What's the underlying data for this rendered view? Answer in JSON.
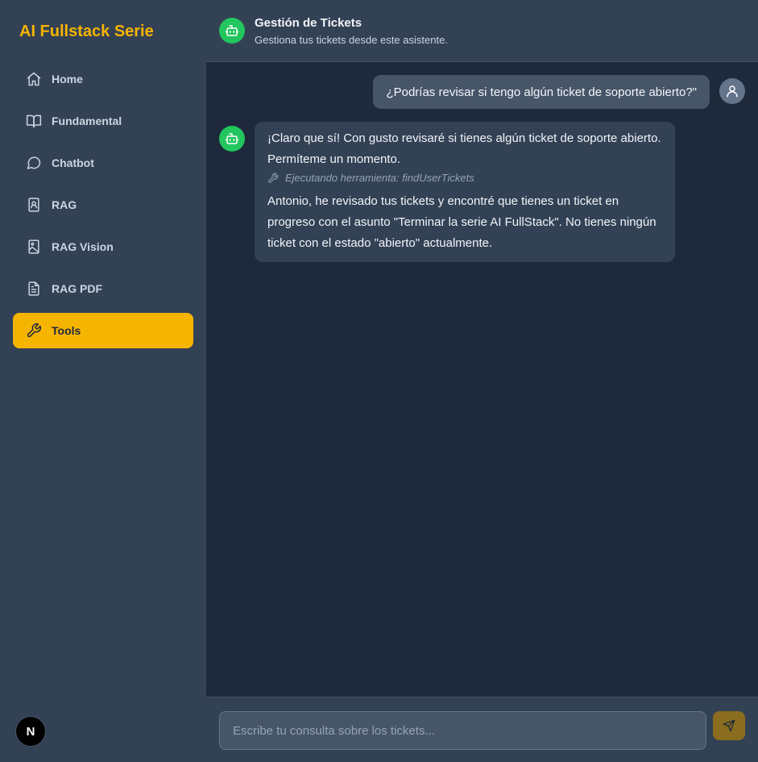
{
  "sidebar": {
    "brand": "AI Fullstack Serie",
    "items": [
      {
        "label": "Home",
        "icon": "home-icon"
      },
      {
        "label": "Fundamental",
        "icon": "book-open-icon"
      },
      {
        "label": "Chatbot",
        "icon": "chat-bubble-icon"
      },
      {
        "label": "RAG",
        "icon": "contact-book-icon"
      },
      {
        "label": "RAG Vision",
        "icon": "image-book-icon"
      },
      {
        "label": "RAG PDF",
        "icon": "file-text-icon"
      },
      {
        "label": "Tools",
        "icon": "wrench-icon",
        "active": true
      }
    ],
    "footer_badge": "N"
  },
  "header": {
    "title": "Gestión de Tickets",
    "subtitle": "Gestiona tus tickets desde este asistente.",
    "icon": "bot-icon"
  },
  "messages": [
    {
      "role": "user",
      "text": "¿Podrías revisar si tengo algún ticket de soporte abierto?\""
    },
    {
      "role": "assistant",
      "text_before": "¡Claro que sí! Con gusto revisaré si tienes algún ticket de soporte abierto. Permíteme un momento.",
      "tool_call": "Ejecutando herramienta: findUserTickets",
      "text_after": "Antonio, he revisado tus tickets y encontré que tienes un ticket en progreso con el asunto \"Terminar la serie AI FullStack\". No tienes ningún ticket con el estado \"abierto\" actualmente."
    }
  ],
  "input": {
    "placeholder": "Escribe tu consulta sobre los tickets...",
    "value": ""
  },
  "colors": {
    "accent": "#f5b400",
    "bot": "#22c55e",
    "background": "#1e293b",
    "panel": "#334155"
  }
}
